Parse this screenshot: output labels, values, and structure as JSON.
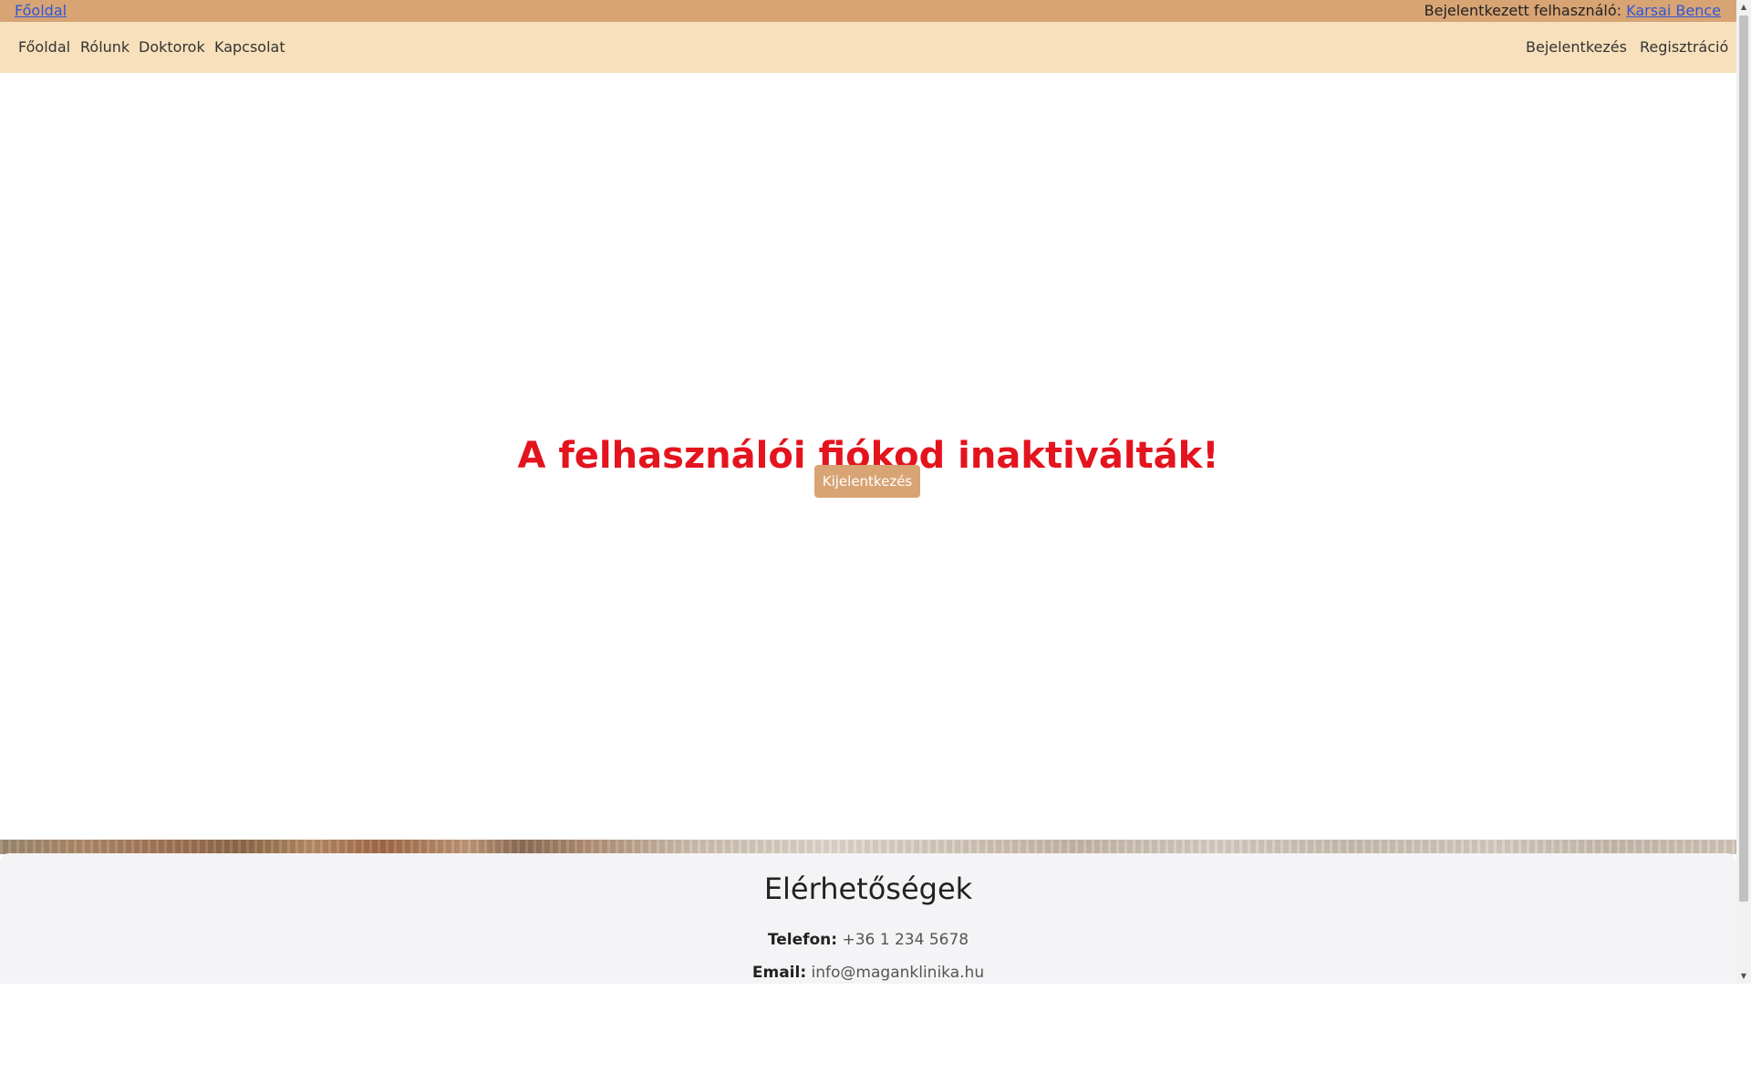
{
  "topbar": {
    "home_link": "Főoldal",
    "logged_in_label": "Bejelentkezett felhasználó:",
    "user_name": "Karsai Bence"
  },
  "navbar": {
    "left_items": [
      "Főoldal",
      "Rólunk",
      "Doktorok",
      "Kapcsolat"
    ],
    "right_items": [
      "Bejelentkezés",
      "Regisztráció"
    ]
  },
  "main": {
    "message": "A felhasználói fiókod inaktiválták!",
    "logout_label": "Kijelentkezés"
  },
  "contact": {
    "title": "Elérhetőségek",
    "phone_label": "Telefon:",
    "phone_value": "+36 1 234 5678",
    "email_label": "Email:",
    "email_value": "info@maganklinika.hu"
  },
  "scrollbar": {
    "up_icon": "triangle-up",
    "down_icon": "triangle-down"
  },
  "colors": {
    "topbar": "#d8a474",
    "navbar": "#f7e0bb",
    "message": "#e3141e",
    "button": "#d8a474",
    "footer": "#f4f4f6",
    "link": "#2f57d8"
  }
}
